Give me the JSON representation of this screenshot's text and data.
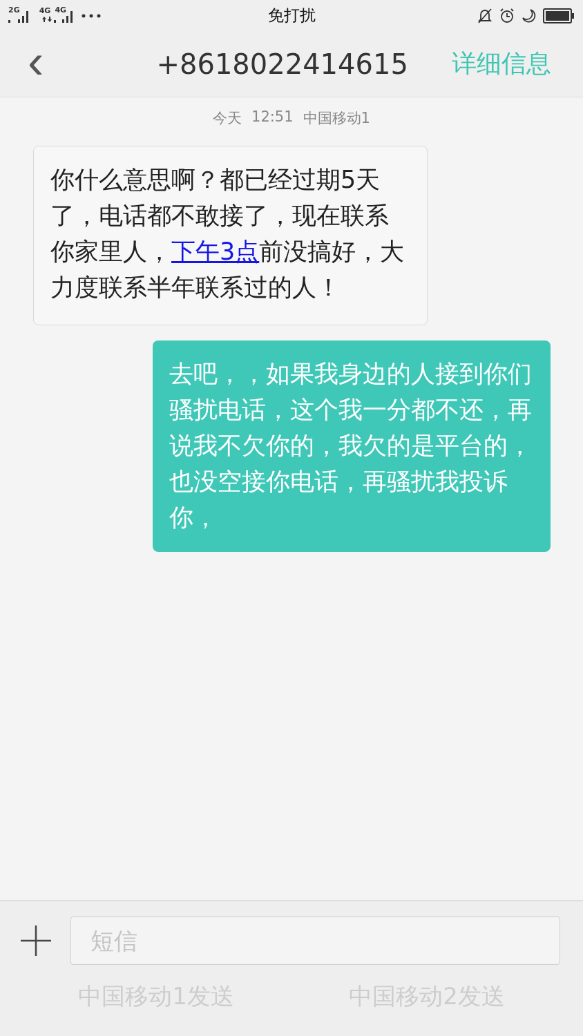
{
  "status_bar": {
    "signal_1_label": "2G",
    "signal_2_label": "4G",
    "signal_2_data_label": "4G",
    "title": "免打扰"
  },
  "header": {
    "back": "‹",
    "contact": "+8618022414615",
    "details_link": "详细信息"
  },
  "timestamp": {
    "day": "今天",
    "time": "12:51",
    "carrier": "中国移动1"
  },
  "messages": [
    {
      "kind": "received",
      "segments": [
        {
          "kind": "text",
          "text": "你什么意思啊？都已经过期5天了，电话都不敢接了，现在联系你家里人，"
        },
        {
          "kind": "link",
          "text": "下午3点"
        },
        {
          "kind": "text",
          "text": "前没搞好，大力度联系半年联系过的人！"
        }
      ]
    },
    {
      "kind": "sent",
      "segments": [
        {
          "kind": "text",
          "text": "去吧，，如果我身边的人接到你们骚扰电话，这个我一分都不还，再说我不欠你的，我欠的是平台的，也没空接你电话，再骚扰我投诉你，"
        }
      ]
    }
  ],
  "composer": {
    "placeholder": "短信"
  },
  "send_buttons": [
    {
      "label": "中国移动1发送",
      "disabled": true
    },
    {
      "label": "中国移动2发送",
      "disabled": true
    }
  ]
}
